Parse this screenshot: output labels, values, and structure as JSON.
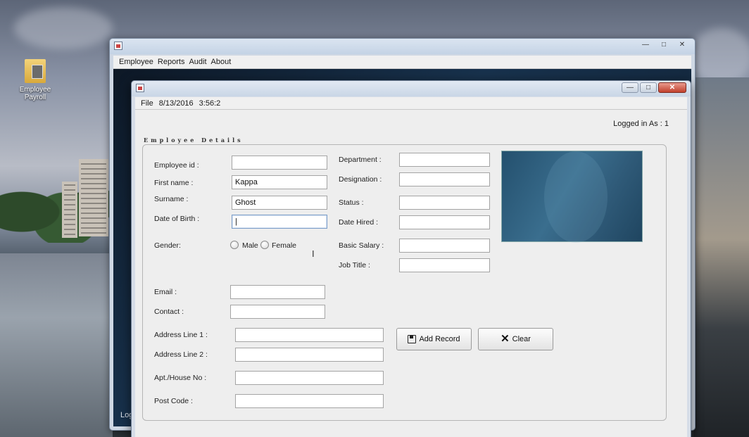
{
  "desktop": {
    "icon_label_line1": "Employee",
    "icon_label_line2": "Payroll"
  },
  "back_window": {
    "menu": [
      "Employee",
      "Reports",
      "Audit",
      "About"
    ],
    "status_fragment": "Logg",
    "controls": {
      "minimize": "—",
      "maximize": "□",
      "close": "✕"
    }
  },
  "front_window": {
    "menu": {
      "file": "File",
      "date": "8/13/2016",
      "time": "3:56:2"
    },
    "controls": {
      "minimize": "—",
      "maximize": "□",
      "close": "✕"
    },
    "logged_in": "Logged in As :  1",
    "section_title": "Employee Details",
    "labels": {
      "employee_id": "Employee id :",
      "first_name": "First name :",
      "surname": "Surname :",
      "dob": "Date of Birth :",
      "gender": "Gender:",
      "male": "Male",
      "female": "Female",
      "department": "Department :",
      "designation": "Designation :",
      "status": "Status :",
      "date_hired": "Date Hired :",
      "basic_salary": "Basic Salary :",
      "job_title": "Job Title :",
      "email": "Email :",
      "contact": "Contact :",
      "address1": "Address Line 1 :",
      "address2": "Address Line 2 :",
      "apt": "Apt./House No :",
      "post_code": "Post Code :"
    },
    "values": {
      "employee_id": "",
      "first_name": "Kappa",
      "surname": "Ghost",
      "dob": "|",
      "department": "",
      "designation": "",
      "status": "",
      "date_hired": "",
      "basic_salary": "",
      "job_title": "",
      "email": "",
      "contact": "",
      "address1": "",
      "address2": "",
      "apt": "",
      "post_code": ""
    },
    "buttons": {
      "add_record": "Add Record",
      "clear": "Clear"
    },
    "icons": {
      "add_record": "save-disk-icon",
      "clear": "x-icon"
    }
  }
}
